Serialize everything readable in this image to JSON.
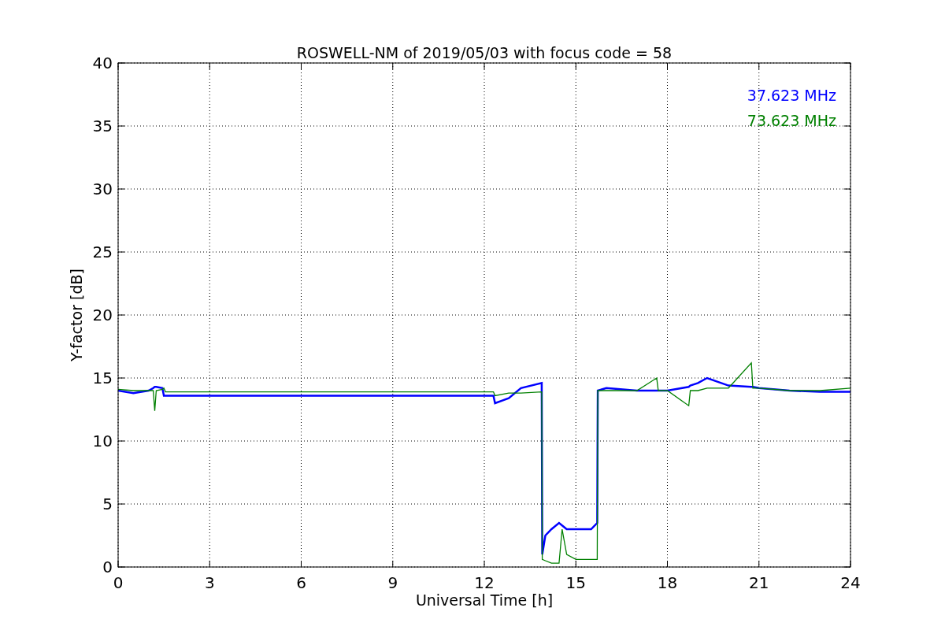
{
  "chart_data": {
    "type": "line",
    "title": "ROSWELL-NM of 2019/05/03 with focus code = 58",
    "xlabel": "Universal Time [h]",
    "ylabel": "Y-factor [dB]",
    "x": [
      0,
      0.5,
      1,
      1.15,
      1.2,
      1.25,
      1.45,
      1.5,
      1.55,
      12.3,
      12.35,
      12.8,
      13.2,
      13.88,
      13.9,
      14.0,
      14.2,
      14.45,
      14.55,
      14.7,
      15,
      15.5,
      15.7,
      15.72,
      16,
      17,
      17.65,
      17.7,
      18,
      18.7,
      18.75,
      19,
      19.3,
      20,
      20.75,
      20.8,
      21,
      22,
      23,
      24
    ],
    "series": [
      {
        "name": "37.623 MHz",
        "color": "#0000ff",
        "values": [
          14,
          13.8,
          14,
          14.2,
          14.3,
          14.3,
          14.2,
          13.6,
          13.6,
          13.6,
          13,
          13.4,
          14.2,
          14.6,
          1,
          2.5,
          3,
          3.5,
          3.3,
          3,
          3,
          3,
          3.5,
          14,
          14.2,
          14,
          14,
          14,
          14,
          14.3,
          14.4,
          14.6,
          15,
          14.4,
          14.3,
          14.3,
          14.2,
          14,
          13.9,
          13.9
        ]
      },
      {
        "name": "73.623 MHz",
        "color": "#008000",
        "values": [
          14.1,
          14,
          14,
          14,
          12.4,
          14,
          14.1,
          14.2,
          13.9,
          13.9,
          13.6,
          13.8,
          13.8,
          13.9,
          0.6,
          0.5,
          0.3,
          0.3,
          3,
          1,
          0.6,
          0.6,
          0.6,
          14,
          14,
          14,
          15,
          14,
          14,
          12.8,
          14,
          14,
          14.2,
          14.2,
          16.2,
          14.2,
          14.2,
          14,
          14,
          14.2
        ]
      }
    ],
    "xlim": [
      0,
      24
    ],
    "ylim": [
      0,
      40
    ],
    "xticks": [
      0,
      3,
      6,
      9,
      12,
      15,
      18,
      21,
      24
    ],
    "yticks": [
      0,
      5,
      10,
      15,
      20,
      25,
      30,
      35,
      40
    ],
    "grid": true
  }
}
